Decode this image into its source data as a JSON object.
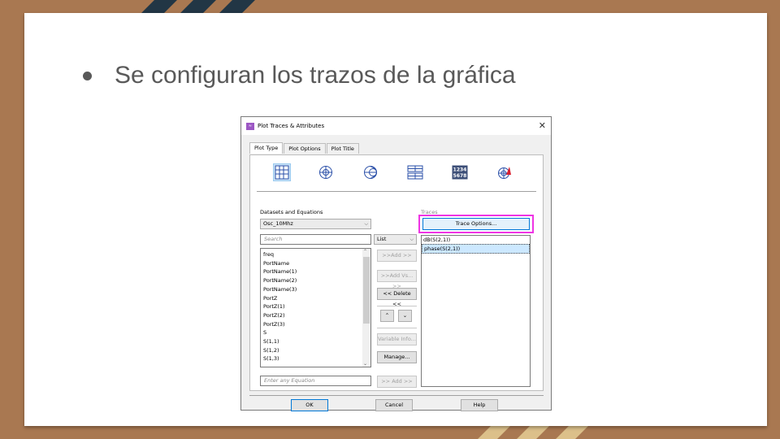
{
  "slide": {
    "bullet": "Se configuran los trazos de la gráfica"
  },
  "dialog": {
    "title": "Plot Traces & Attributes",
    "tabs": [
      "Plot Type",
      "Plot Options",
      "Plot Title"
    ],
    "datasets_label": "Datasets and Equations",
    "dataset_selected": "Osc_10Mhz",
    "search_placeholder": "Search",
    "list_mode": "List",
    "variables": [
      "freq",
      "PortName",
      "PortName(1)",
      "PortName(2)",
      "PortName(3)",
      "PortZ",
      "PortZ(1)",
      "PortZ(2)",
      "PortZ(3)",
      "S",
      "S(1,1)",
      "S(1,2)",
      "S(1,3)"
    ],
    "buttons": {
      "add": ">>Add >>",
      "add_vs": ">>Add Vs... >>",
      "delete": "<< Delete <<",
      "variable_info": "Variable Info...",
      "manage": "Manage...",
      "add_eq": ">> Add >>",
      "trace_options": "Trace Options...",
      "ok": "OK",
      "cancel": "Cancel",
      "help": "Help"
    },
    "traces_label": "Traces",
    "traces": [
      "dB(S(2,1))",
      "phase(S(2,1))"
    ],
    "equation_placeholder": "Enter any Equation",
    "close_symbol": "✕"
  }
}
